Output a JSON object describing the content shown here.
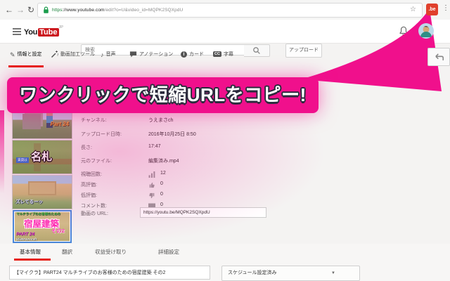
{
  "colors": {
    "accent_pink": "#f0108c",
    "youtube_red": "#cc181e",
    "active_red": "#e62117",
    "extension_red": "#e0402c",
    "lock_green": "#1a9c4b",
    "selected_thumb_blue": "#4a86d8"
  },
  "icons": {
    "back": "←",
    "forward": "→",
    "reload": "↻",
    "star": "☆",
    "menu_dots": "⋮",
    "pencil": "✎",
    "note": "♪",
    "info_i": "i",
    "cc": "CC",
    "caret": "▼"
  },
  "browser": {
    "extension_badge": ".be",
    "url": {
      "protocol": "https",
      "host": "://www.youtube.com",
      "path": "/edit?o=U&video_id=MQPK2SQXpdU"
    }
  },
  "header": {
    "logo_you": "You",
    "logo_tube": "Tube",
    "logo_region": "JP",
    "search_placeholder": "検索",
    "upload_label": "アップロード"
  },
  "tabs": [
    {
      "label": "情報と設定"
    },
    {
      "label": "動画加工ツール"
    },
    {
      "label": "音声"
    },
    {
      "label": "アノテーション"
    },
    {
      "label": "カード"
    },
    {
      "label": "字幕"
    }
  ],
  "callout": {
    "text": "ワンクリックで短縮URLをコピー!"
  },
  "video_info": {
    "rows": [
      {
        "label": "チャンネル:",
        "value": "うえまさch"
      },
      {
        "label": "アップロード日時:",
        "value": "2016年10月25日 8:50"
      },
      {
        "label": "長さ:",
        "value": "17:47"
      },
      {
        "label": "元のファイル:",
        "value": "編集済み.mp4"
      },
      {
        "label": "視聴回数:",
        "value": "12"
      },
      {
        "label": "高評価:",
        "value": "0"
      },
      {
        "label": "低評価:",
        "value": "0"
      },
      {
        "label": "コメント数:",
        "value": "0"
      },
      {
        "label": "動画の URL:",
        "value": "https://youtu.be/MQPK2SQXpdU"
      }
    ]
  },
  "thumbnails": [
    {
      "caption": "Part 24"
    },
    {
      "caption": "名札",
      "badge": "賃貸は"
    },
    {
      "caption": "ズレてるーッ"
    },
    {
      "top_line": "マルチライブのお客様のための",
      "main": "宿屋建築",
      "sub": "その2",
      "part": "PART 24",
      "logo": "UEMASAcraft"
    }
  ],
  "bottom_tabs": [
    {
      "label": "基本情報"
    },
    {
      "label": "翻訳"
    },
    {
      "label": "収益受け取り"
    },
    {
      "label": "詳細設定"
    }
  ],
  "editor": {
    "title_value": "【マイクラ】PART24 マルチライブのお客様のための宿屋建築 その2",
    "schedule_value": "スケジュール設定済み"
  }
}
